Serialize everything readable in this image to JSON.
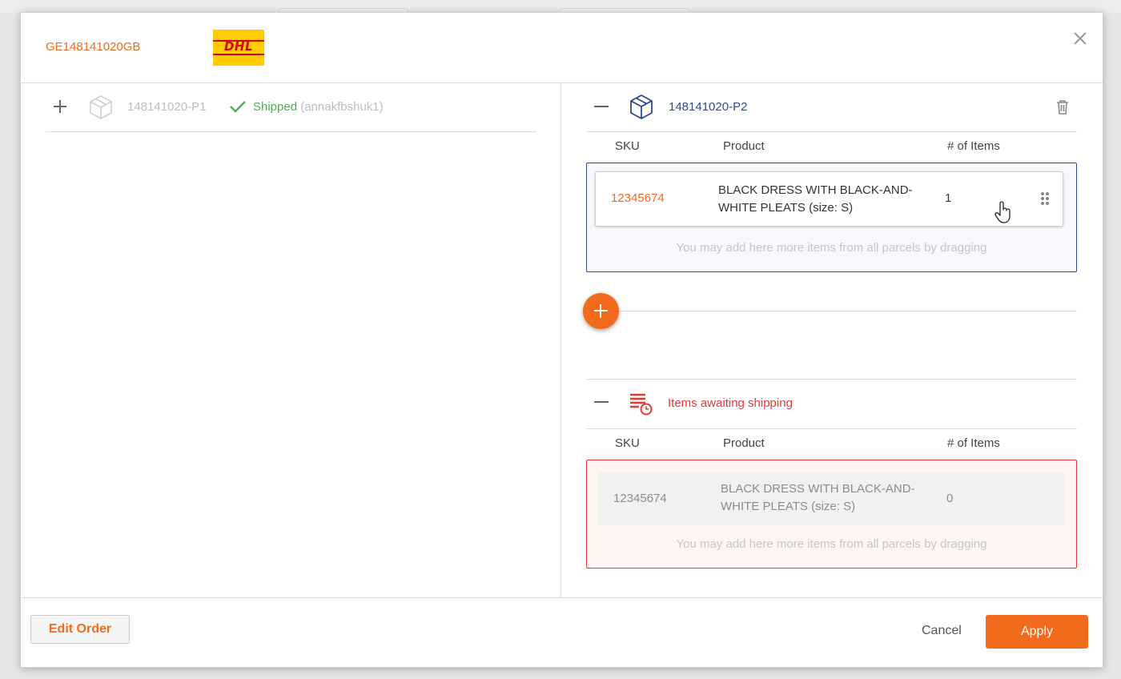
{
  "modal": {
    "tracking_number": "GE148141020GB",
    "carrier_logo": {
      "text": "DHL",
      "background": "#ffcc00",
      "color": "#d40511"
    }
  },
  "left_parcel": {
    "parcel_id": "148141020-P1",
    "status": "Shipped",
    "status_user": "(annakfbshuk1)"
  },
  "right_parcel": {
    "parcel_id": "148141020-P2",
    "columns": {
      "sku": "SKU",
      "product": "Product",
      "items": "# of Items"
    },
    "items": [
      {
        "sku": "12345674",
        "product": "BLACK DRESS WITH BLACK-AND-WHITE PLEATS (size: S)",
        "qty": "1"
      }
    ],
    "hint": "You may add here more items from all parcels by dragging"
  },
  "awaiting": {
    "title": "Items awaiting shipping",
    "columns": {
      "sku": "SKU",
      "product": "Product",
      "items": "# of Items"
    },
    "items": [
      {
        "sku": "12345674",
        "product": "BLACK DRESS WITH BLACK-AND-WHITE PLEATS (size: S)",
        "qty": "0"
      }
    ],
    "hint": "You may add here more items from all parcels by dragging"
  },
  "footer": {
    "edit_label": "Edit Order",
    "cancel_label": "Cancel",
    "apply_label": "Apply"
  },
  "colors": {
    "accent": "#f26a1b",
    "parcel_blue": "#2d4a8a",
    "awaiting_red": "#e53935",
    "shipped_green": "#4caf50"
  }
}
